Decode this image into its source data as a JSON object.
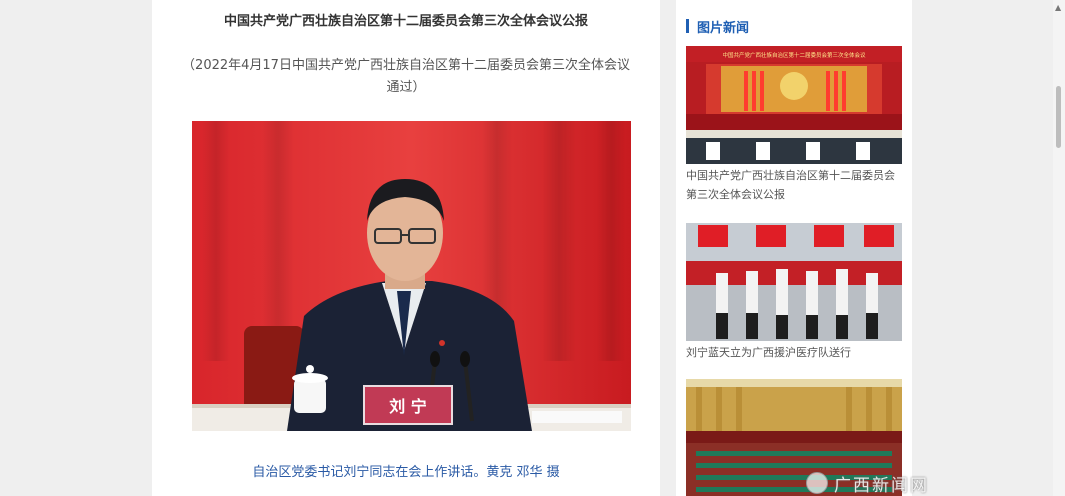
{
  "article": {
    "title": "中国共产党广西壮族自治区第十二届委员会第三次全体会议公报",
    "subtitle": "（2022年4月17日中国共产党广西壮族自治区第十二届委员会第三次全体会议通过）",
    "photo_nameplate": "刘 宁",
    "caption": "自治区党委书记刘宁同志在会上作讲话。黄克  邓华  摄"
  },
  "sidebar": {
    "title": "图片新闻",
    "items": [
      {
        "banner": "中国共产党广西壮族自治区第十二届委员会第三次全体会议",
        "caption": "中国共产党广西壮族自治区第十二届委员会第三次全体会议公报"
      },
      {
        "caption": "刘宁蓝天立为广西援沪医疗队送行"
      },
      {
        "caption": ""
      }
    ]
  },
  "watermark": {
    "text": "广西新闻网"
  },
  "colors": {
    "accent": "#1f5fb3",
    "caption_link": "#2a5aa5",
    "curtain_red": "#c8161d"
  }
}
